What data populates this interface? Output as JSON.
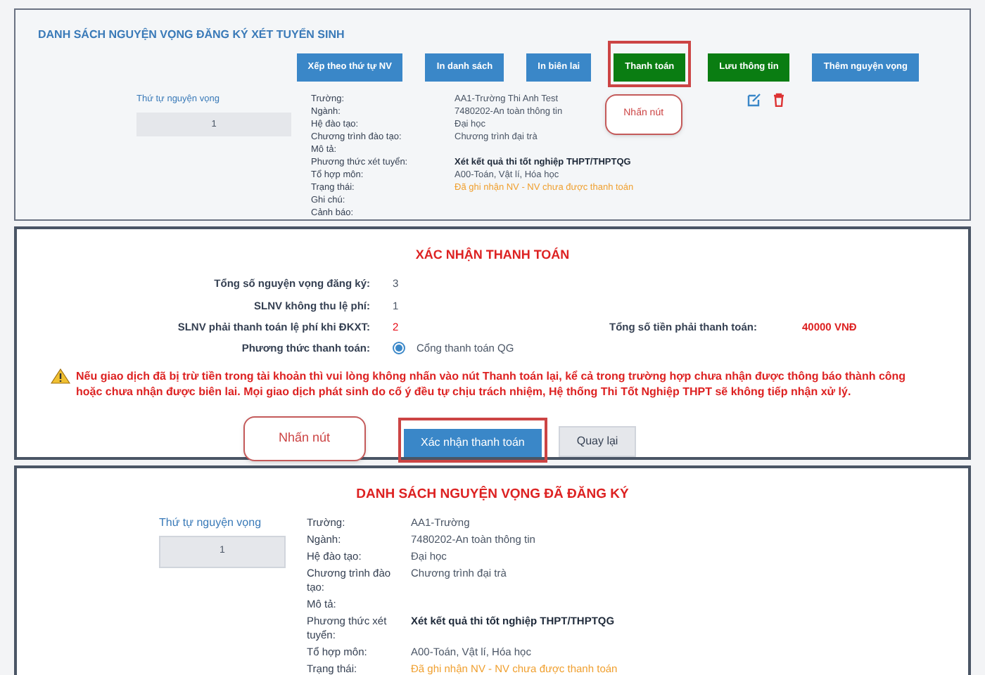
{
  "registered_list": {
    "title": "DANH SÁCH NGUYỆN VỌNG ĐĂNG KÝ XÉT TUYỂN SINH",
    "buttons": [
      {
        "label": "Xếp theo thứ tự NV",
        "kind": "primary",
        "highlighted": false
      },
      {
        "label": "In danh sách",
        "kind": "primary",
        "highlighted": false
      },
      {
        "label": "In biên lai",
        "kind": "primary",
        "highlighted": false
      },
      {
        "label": "Thanh toán",
        "kind": "success",
        "highlighted": true,
        "callout": "Nhấn nút"
      },
      {
        "label": "Lưu thông tin",
        "kind": "success",
        "highlighted": false
      },
      {
        "label": "Thêm nguyện vọng",
        "kind": "primary",
        "highlighted": false
      }
    ],
    "order_label": "Thứ tự nguyện vọng",
    "order_value": "1",
    "fields": [
      {
        "label": "Trường:",
        "value": "AA1-Trường Thi Anh Test",
        "kind": "normal"
      },
      {
        "label": "Ngành:",
        "value": "7480202-An toàn thông tin",
        "kind": "normal"
      },
      {
        "label": "Hệ đào tạo:",
        "value": "Đại học",
        "kind": "normal"
      },
      {
        "label": "Chương trình đào tạo:",
        "value": "Chương trình đại trà",
        "kind": "normal"
      },
      {
        "label": "Mô tả:"
      },
      {
        "label": "Phương thức xét tuyển:",
        "value": "Xét kết quả thi tốt nghiệp THPT/THPTQG",
        "kind": "bold"
      },
      {
        "label": "Tổ hợp môn:",
        "value": "A00-Toán, Vật lí, Hóa học",
        "kind": "normal"
      },
      {
        "label": "Trạng thái:",
        "value": "Đã ghi nhận NV - NV chưa được thanh toán",
        "kind": "status"
      },
      {
        "label": "Ghi chú:"
      },
      {
        "label": "Cảnh báo:"
      }
    ]
  },
  "payment_confirmation": {
    "title": "XÁC NHẬN THANH TOÁN",
    "rows": [
      {
        "label": "Tổng số nguyện vọng đăng ký:",
        "value": "3",
        "kind": "normal"
      },
      {
        "label": "SLNV không thu lệ phí:",
        "value": "1",
        "kind": "normal"
      },
      {
        "label": "SLNV phải thanh toán lệ phí khi ĐKXT:",
        "value": "2",
        "kind": "alert"
      }
    ],
    "total_label": "Tổng số tiền phải thanh toán:",
    "total_value": "40000 VNĐ",
    "method_label": "Phương thức thanh toán:",
    "methods": [
      {
        "label": "Cổng thanh toán QG",
        "selected": true
      }
    ],
    "warning": "Nếu giao dịch đã bị trừ tiền trong tài khoản thì vui lòng không nhấn vào nút Thanh toán lại, kể cả trong trường hợp chưa nhận được thông báo thành công hoặc chưa nhận được biên lai. Mọi giao dịch phát sinh do cố ý đều tự chịu trách nhiệm, Hệ thống Thi Tốt Nghiệp THPT sẽ không tiếp nhận xử lý.",
    "buttons": [
      {
        "label": "Xác nhận thanh toán",
        "kind": "primary",
        "highlighted": true
      },
      {
        "label": "Quay lại",
        "kind": "secondary",
        "highlighted": false
      }
    ],
    "callout": "Nhấn nút"
  },
  "confirmed_list": {
    "title": "DANH SÁCH NGUYỆN VỌNG ĐÃ ĐĂNG KÝ",
    "order_label": "Thứ tự nguyện vọng",
    "order_value": "1",
    "fields": [
      {
        "label": "Trường:",
        "value": "AA1-Trường",
        "kind": "normal"
      },
      {
        "label": "Ngành:",
        "value": "7480202-An toàn thông tin",
        "kind": "normal"
      },
      {
        "label": "Hệ đào tạo:",
        "value": "Đại học",
        "kind": "normal"
      },
      {
        "label": "Chương trình đào tạo:",
        "value": "Chương trình đại trà",
        "kind": "normal"
      },
      {
        "label": "Mô tả:"
      },
      {
        "label": "Phương thức xét tuyển:",
        "value": "Xét kết quả thi tốt nghiệp THPT/THPTQG",
        "kind": "bold"
      },
      {
        "label": "Tổ hợp môn:",
        "value": "A00-Toán, Vật lí, Hóa học",
        "kind": "normal"
      },
      {
        "label": "Trạng thái:",
        "value": "Đã ghi nhận NV - NV chưa được thanh toán",
        "kind": "status"
      }
    ]
  }
}
